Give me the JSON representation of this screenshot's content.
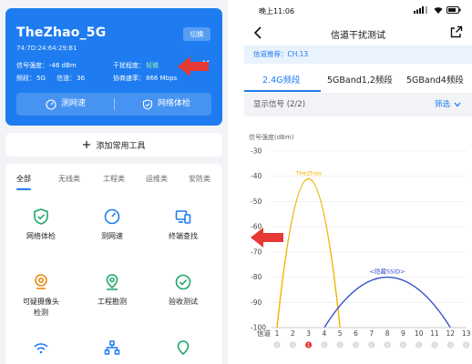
{
  "left": {
    "card": {
      "ssid": "TheZhao_5G",
      "mac": "74:7D:24:64:29:B1",
      "switch_label": "切换",
      "signal_label": "信号强度：",
      "signal_value": "-46 dBm",
      "interference_label": "干扰程度：",
      "interference_value": "轻微",
      "band_label": "频段：",
      "band_value": "5G",
      "channel_label": "信道：",
      "channel_value": "36",
      "rate_label": "协商速率：",
      "rate_value": "866 Mbps",
      "speed_test_label": "测网速",
      "network_check_label": "网络体检"
    },
    "add_tools_label": "添加常用工具",
    "tabs": [
      "全部",
      "无线类",
      "工程类",
      "运维类",
      "安防类"
    ],
    "tools": [
      {
        "label": "网络体检",
        "icon": "shield-check-icon"
      },
      {
        "label": "测网速",
        "icon": "speedometer-icon"
      },
      {
        "label": "终端查找",
        "icon": "devices-icon"
      },
      {
        "label": "可疑摄像头\n检测",
        "icon": "camera-detect-icon"
      },
      {
        "label": "工程勘测",
        "icon": "location-pin-icon"
      },
      {
        "label": "验收测试",
        "icon": "check-circle-icon"
      }
    ],
    "colors": {
      "accent": "#1e7cf0",
      "arrow": "#e53935",
      "bg": "#f1f3f6"
    }
  },
  "right": {
    "status": {
      "time": "晚上11:06"
    },
    "title": "信道干扰测试",
    "recommend": "信道推荐：CH.13",
    "bands": [
      "2.4G频段",
      "5GBand1,2频段",
      "5GBand4频段"
    ],
    "filter_left": "显示信号 (2/2)",
    "filter_right": "筛选"
  },
  "chart_data": {
    "type": "line",
    "ylabel": "信号强度(dBm)",
    "xlabel": "信道",
    "ylim": [
      -100,
      -30
    ],
    "y_ticks": [
      -30,
      -40,
      -50,
      -60,
      -70,
      -80,
      -90,
      -100
    ],
    "y_tick_labels": [
      "-30",
      "-40",
      "-50",
      "-60",
      "-70",
      "-80",
      "-90",
      "-100"
    ],
    "x_ticks": [
      1,
      2,
      3,
      4,
      5,
      6,
      7,
      8,
      9,
      10,
      11,
      12,
      13
    ],
    "x_tick_labels": [
      "1",
      "2",
      "3",
      "4",
      "5",
      "6",
      "7",
      "8",
      "9",
      "10",
      "11",
      "12",
      "13"
    ],
    "highlight_channel": 3,
    "series": [
      {
        "name": "TheZhao",
        "center": 3,
        "x_range": [
          1,
          5
        ],
        "peak": -41,
        "color": "#f0b400"
      },
      {
        "name": "<隐藏SSID>",
        "center": 8,
        "x_range": [
          4,
          12
        ],
        "peak": -80,
        "color": "#3552c8"
      }
    ]
  }
}
